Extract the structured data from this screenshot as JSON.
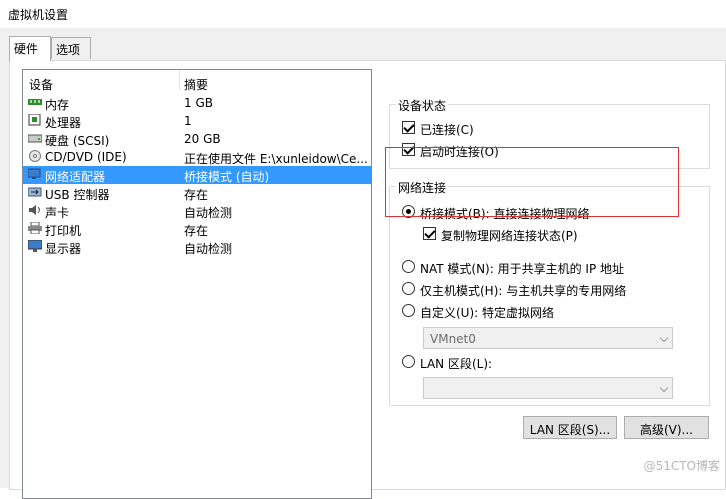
{
  "window": {
    "title": "虚拟机设置"
  },
  "tabs": [
    {
      "label": "硬件",
      "active": true
    },
    {
      "label": "选项",
      "active": false
    }
  ],
  "device_list": {
    "columns": [
      "设备",
      "摘要"
    ],
    "rows": [
      {
        "name": "内存",
        "summary": "1 GB",
        "icon": "memory-icon",
        "selected": false
      },
      {
        "name": "处理器",
        "summary": "1",
        "icon": "cpu-icon",
        "selected": false
      },
      {
        "name": "硬盘 (SCSI)",
        "summary": "20 GB",
        "icon": "harddisk-icon",
        "selected": false
      },
      {
        "name": "CD/DVD (IDE)",
        "summary": "正在使用文件 E:\\xunleidow\\Ce...",
        "icon": "cd-icon",
        "selected": false
      },
      {
        "name": "网络适配器",
        "summary": "桥接模式 (自动)",
        "icon": "network-adapter-icon",
        "selected": true
      },
      {
        "name": "USB 控制器",
        "summary": "存在",
        "icon": "usb-icon",
        "selected": false
      },
      {
        "name": "声卡",
        "summary": "自动检测",
        "icon": "sound-icon",
        "selected": false
      },
      {
        "name": "打印机",
        "summary": "存在",
        "icon": "printer-icon",
        "selected": false
      },
      {
        "name": "显示器",
        "summary": "自动检测",
        "icon": "display-icon",
        "selected": false
      }
    ]
  },
  "device_status": {
    "title": "设备状态",
    "connected": "已连接(C)",
    "connect_at_power_on": "启动时连接(O)"
  },
  "network": {
    "title": "网络连接",
    "bridged": "桥接模式(B): 直接连接物理网络",
    "replicate": "复制物理网络连接状态(P)",
    "nat": "NAT 模式(N): 用于共享主机的 IP 地址",
    "host_only": "仅主机模式(H): 与主机共享的专用网络",
    "custom": "自定义(U): 特定虚拟网络",
    "custom_value": "VMnet0",
    "lan": "LAN 区段(L):",
    "lan_value": ""
  },
  "buttons": {
    "lan_segments": "LAN 区段(S)...",
    "advanced": "高级(V)..."
  },
  "watermark": "@51CTO博客",
  "colors": {
    "selection": "#3399ff",
    "highlight_box": "#e03030"
  }
}
